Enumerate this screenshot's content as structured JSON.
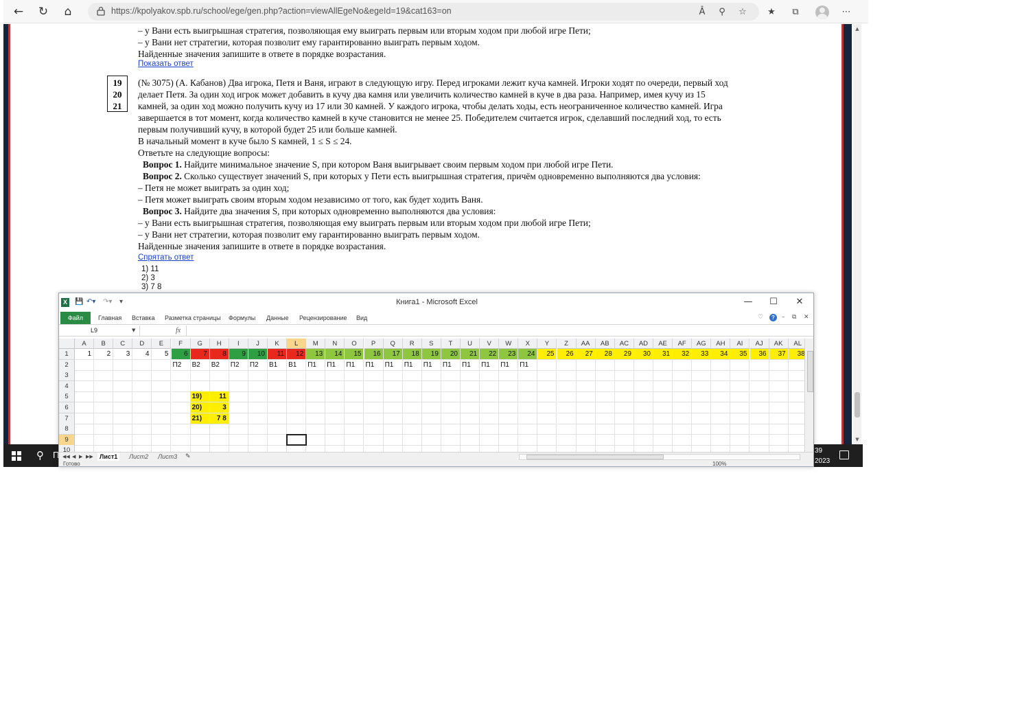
{
  "browser": {
    "url": "https://kpolyakov.spb.ru/school/ege/gen.php?action=viewAllEgeNo&egeId=19&cat163=on",
    "icons": [
      "back-icon",
      "refresh-icon",
      "home-icon",
      "lock-icon",
      "read-aloud-icon",
      "zoom-icon",
      "favorite-add-icon",
      "favorites-icon",
      "collections-icon",
      "profile-icon",
      "more-icon"
    ],
    "read_aloud_label": "Â"
  },
  "page": {
    "prev_tail": [
      "– у Вани есть выигрышная стратегия, позволяющая ему выиграть первым или вторым ходом при любой игре Пети;",
      "– у Вани нет стратегии, которая позволит ему гарантированно выиграть первым ходом.",
      "Найденные значения запишите в ответе в порядке возрастания."
    ],
    "show_answer_link": "Показать ответ",
    "task_numbers": [
      "19",
      "20",
      "21"
    ],
    "task_lines": [
      "(№ 3075) (А. Кабанов) Два игрока, Петя и Ваня, играют в следующую игру. Перед игроками лежит куча камней. Игроки ходят по очереди, первый ход",
      "делает Петя. За один ход игрок может добавить в кучу два камня или увеличить количество камней в куче в два раза. Например, имея кучу из 15",
      "камней, за один ход можно получить кучу из 17 или 30 камней. У каждого игрока, чтобы делать ходы, есть неограниченное количество камней. Игра",
      "завершается в тот момент, когда количество камней в куче становится не менее 25. Победителем считается игрок, сделавший последний ход, то есть",
      "первым получивший кучу, в которой будет 25 или больше камней.",
      "В начальный момент в куче было S камней, 1 ≤ S ≤ 24.",
      "Ответьте на следующие вопросы:"
    ],
    "q1_label": "Вопрос 1.",
    "q1_text": " Найдите минимальное значение S, при котором Ваня выигрывает своим первым ходом при любой игре Пети.",
    "q2_label": "Вопрос 2.",
    "q2_text": " Сколько существует значений S, при которых у Пети есть выигрышная стратегия, причём одновременно выполняются два условия:",
    "q2_c1": "– Петя не может выиграть за один ход;",
    "q2_c2": "– Петя может выиграть своим вторым ходом независимо от того, как будет ходить Ваня.",
    "q3_label": "Вопрос 3.",
    "q3_text": " Найдите два значения S, при которых одновременно выполняются два условия:",
    "q3_c1": "– у Вани есть выигрышная стратегия, позволяющая ему выиграть первым или вторым ходом при любой игре Пети;",
    "q3_c2": "– у Вани нет стратегии, которая позволит ему гарантированно выиграть первым ходом.",
    "q3_c3": "Найденные значения запишите в ответе в порядке возрастания.",
    "hide_answer_link": "Спрятать ответ",
    "answers": [
      "1) 11",
      "2) 3",
      "3) 7 8"
    ]
  },
  "excel": {
    "title": "Книга1 - Microsoft Excel",
    "file_tab": "Файл",
    "ribbon_tabs": [
      "Главная",
      "Вставка",
      "Разметка страницы",
      "Формулы",
      "Данные",
      "Рецензирование",
      "Вид"
    ],
    "name_box": "L9",
    "fx_label": "fx",
    "columns": [
      "A",
      "B",
      "C",
      "D",
      "E",
      "F",
      "G",
      "H",
      "I",
      "J",
      "K",
      "L",
      "M",
      "N",
      "O",
      "P",
      "Q",
      "R",
      "S",
      "T",
      "U",
      "V",
      "W",
      "X",
      "Y",
      "Z",
      "AA",
      "AB",
      "AC",
      "AD",
      "AE",
      "AF",
      "AG",
      "AH",
      "AI",
      "AJ",
      "AK",
      "AL"
    ],
    "rows": [
      "1",
      "2",
      "3",
      "4",
      "5",
      "6",
      "7",
      "8",
      "9",
      "10"
    ],
    "selected_column": "L",
    "selected_row": "9",
    "row1_values": [
      "1",
      "2",
      "3",
      "4",
      "5",
      "6",
      "7",
      "8",
      "9",
      "10",
      "11",
      "12",
      "13",
      "14",
      "15",
      "16",
      "17",
      "18",
      "19",
      "20",
      "21",
      "22",
      "23",
      "24",
      "25",
      "26",
      "27",
      "28",
      "29",
      "30",
      "31",
      "32",
      "33",
      "34",
      "35",
      "36",
      "37",
      "38"
    ],
    "row2_values": [
      "",
      "",
      "",
      "",
      "",
      "П2",
      "В2",
      "В2",
      "П2",
      "П2",
      "В1",
      "В1",
      "П1",
      "П1",
      "П1",
      "П1",
      "П1",
      "П1",
      "П1",
      "П1",
      "П1",
      "П1",
      "П1",
      "П1",
      "",
      "",
      "",
      "",
      "",
      "",
      "",
      "",
      "",
      "",
      "",
      "",
      "",
      ""
    ],
    "row1_fill": [
      "",
      "",
      "",
      "",
      "",
      "green",
      "red",
      "red",
      "green",
      "green",
      "red",
      "red",
      "lightgreen",
      "lightgreen",
      "lightgreen",
      "lightgreen",
      "lightgreen",
      "lightgreen",
      "lightgreen",
      "lightgreen",
      "lightgreen",
      "lightgreen",
      "lightgreen",
      "lightgreen",
      "yellow",
      "yellow",
      "yellow",
      "yellow",
      "yellow",
      "yellow",
      "yellow",
      "yellow",
      "yellow",
      "yellow",
      "yellow",
      "yellow",
      "yellow",
      "yellow"
    ],
    "colors": {
      "green": "#2ea043",
      "red": "#e8271d",
      "lightgreen": "#8ec63f",
      "yellow": "#ffee00",
      "answer_fill": "#ffee00",
      "header_selected": "#f9d68c"
    },
    "answer_cells": [
      {
        "row": "5",
        "col": "G",
        "text": "19)"
      },
      {
        "row": "5",
        "col": "H",
        "text": "11"
      },
      {
        "row": "6",
        "col": "G",
        "text": "20)"
      },
      {
        "row": "6",
        "col": "H",
        "text": "3"
      },
      {
        "row": "7",
        "col": "G",
        "text": "21)"
      },
      {
        "row": "7",
        "col": "H",
        "text": "7 8"
      }
    ],
    "sheets": [
      "Лист1",
      "Лист2",
      "Лист3"
    ],
    "active_sheet": "Лист1",
    "status": "Готово",
    "zoom": "100%",
    "scroll_thumb_label": "III"
  },
  "taskbar": {
    "search_letter": "П",
    "clock_time": "39",
    "clock_date": "2023"
  }
}
